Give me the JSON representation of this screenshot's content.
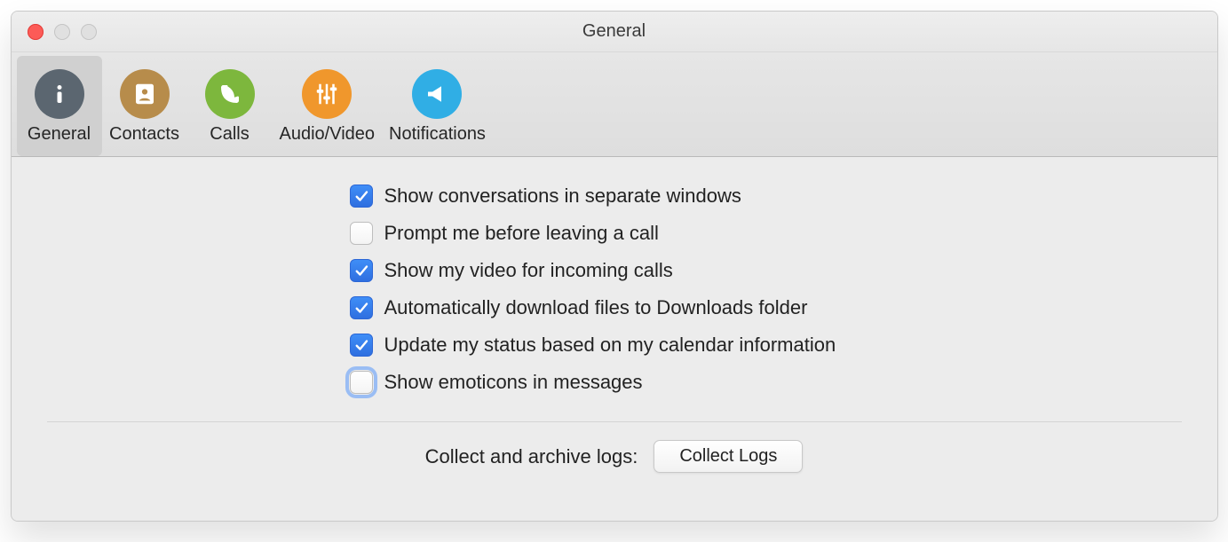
{
  "window": {
    "title": "General"
  },
  "tabs": {
    "general": {
      "label": "General",
      "color": "#5b6670",
      "icon": "info"
    },
    "contacts": {
      "label": "Contacts",
      "color": "#b78c4b",
      "icon": "contacts"
    },
    "calls": {
      "label": "Calls",
      "color": "#7db73d",
      "icon": "phone"
    },
    "audiovideo": {
      "label": "Audio/Video",
      "color": "#f0972c",
      "icon": "sliders"
    },
    "notifications": {
      "label": "Notifications",
      "color": "#30aee5",
      "icon": "megaphone"
    }
  },
  "settings": {
    "separate_windows": {
      "label": "Show conversations in separate windows",
      "checked": true,
      "focused": false
    },
    "prompt_leave_call": {
      "label": "Prompt me before leaving a call",
      "checked": false,
      "focused": false
    },
    "show_my_video": {
      "label": "Show my video for incoming calls",
      "checked": true,
      "focused": false
    },
    "auto_download": {
      "label": "Automatically download files to Downloads folder",
      "checked": true,
      "focused": false
    },
    "calendar_status": {
      "label": "Update my status based on my calendar information",
      "checked": true,
      "focused": false
    },
    "emoticons": {
      "label": "Show emoticons in messages",
      "checked": false,
      "focused": true
    }
  },
  "logs": {
    "label": "Collect and archive logs:",
    "button": "Collect Logs"
  }
}
